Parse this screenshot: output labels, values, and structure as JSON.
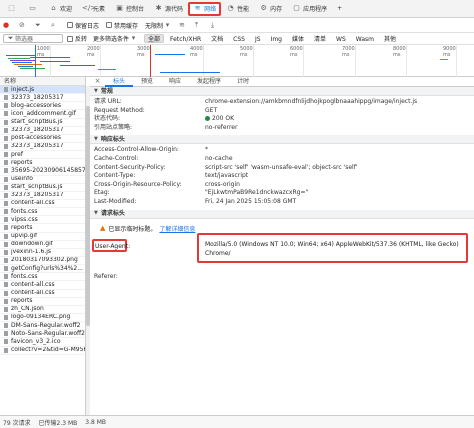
{
  "main_tabs": [
    {
      "label": ""
    },
    {
      "label": ""
    },
    {
      "label": "欢迎"
    },
    {
      "label": "元素"
    },
    {
      "label": "控制台"
    },
    {
      "label": "源代码"
    },
    {
      "label": "网络"
    },
    {
      "label": "性能"
    },
    {
      "label": "内存"
    },
    {
      "label": "应用程序"
    },
    {
      "label": "+"
    }
  ],
  "toolbar": {
    "preserve_log": "保留日志",
    "disable_cache": "禁用缓存",
    "throttling": "无限制"
  },
  "filter": {
    "placeholder": "筛选器",
    "invert": "反转",
    "more_filters": "更多筛选条件",
    "types": [
      "全部",
      "Fetch/XHR",
      "文档",
      "CSS",
      "JS",
      "Img",
      "媒体",
      "清单",
      "WS",
      "Wasm",
      "其他"
    ]
  },
  "timeline": {
    "ticks": [
      "1000 ms",
      "2000 ms",
      "3000 ms",
      "4000 ms",
      "5000 ms",
      "6000 ms",
      "7000 ms",
      "8000 ms",
      "9000 ms"
    ]
  },
  "list": {
    "header": "名称",
    "items": [
      "inject.js",
      "32373_18205317",
      "blog-accessories",
      "icon_addcomment.gif",
      "start_scriptBus.js",
      "32373_18205317",
      "post-accessories",
      "32373_18205317",
      "pref",
      "reports",
      "35695-2023090614585793?...",
      "useinfo",
      "start_scriptBus.js",
      "32373_18205317",
      "content-all.css",
      "fonts.css",
      "vipss.css",
      "reports",
      "upvip.gif",
      "downdown.gif",
      "jvexinn-1.6.js",
      "20180317093302.png",
      "getConfig?urls%34%2...",
      "fonts.css",
      "content-all.css",
      "content-all.css",
      "reports",
      "zh_CN.json",
      "logo-09134ERC.png",
      "DM-Sans-Regular.woff2",
      "Noto-Sans-Regular.woff2",
      "favicon_v3_2.ico",
      "collect?v=2&tid=G-M95F3T..."
    ]
  },
  "status": {
    "requests": "79 次请求",
    "transferred": "已传输2.3 MB",
    "resources": "3.8 MB"
  },
  "detail": {
    "tabs": [
      "标头",
      "预览",
      "响应",
      "发起程序",
      "计时"
    ],
    "general": {
      "title": "常规",
      "rows": [
        {
          "key": "请求 URL:",
          "value": "chrome-extension://amkbmndfnlijdhojkpoglbnaaahippg/image/inject.js"
        },
        {
          "key": "Request Method:",
          "value": "GET"
        },
        {
          "key": "状态代码:",
          "value": "200 OK"
        },
        {
          "key": "引用站点策略:",
          "value": "no-referrer"
        }
      ]
    },
    "response": {
      "title": "响应标头",
      "rows": [
        {
          "key": "Access-Control-Allow-Origin:",
          "value": "*"
        },
        {
          "key": "Cache-Control:",
          "value": "no-cache"
        },
        {
          "key": "Content-Security-Policy:",
          "value": "script-src 'self' 'wasm-unsafe-eval'; object-src 'self'"
        },
        {
          "key": "Content-Type:",
          "value": "text/javascript"
        },
        {
          "key": "Cross-Origin-Resource-Policy:",
          "value": "cross-origin"
        },
        {
          "key": "Etag:",
          "value": "\"EjLkwtmPaB9Re1dnckwazcxRg=\""
        },
        {
          "key": "Last-Modified:",
          "value": "Fri, 24 Jan 2025 15:05:08 GMT"
        }
      ]
    },
    "request": {
      "title": "请求标头",
      "warning": "已显示临时标题。",
      "learn_more": "了解详细信息",
      "referer": "Referer:",
      "ua_key": "User-Agent:",
      "ua_value": "Mozilla/5.0 (Windows NT 10.0; Win64; x64) AppleWebKit/537.36 (KHTML, like Gecko) Chrome/"
    }
  },
  "colors": {
    "accent": "#1a73e8",
    "highlight": "#e53935"
  }
}
